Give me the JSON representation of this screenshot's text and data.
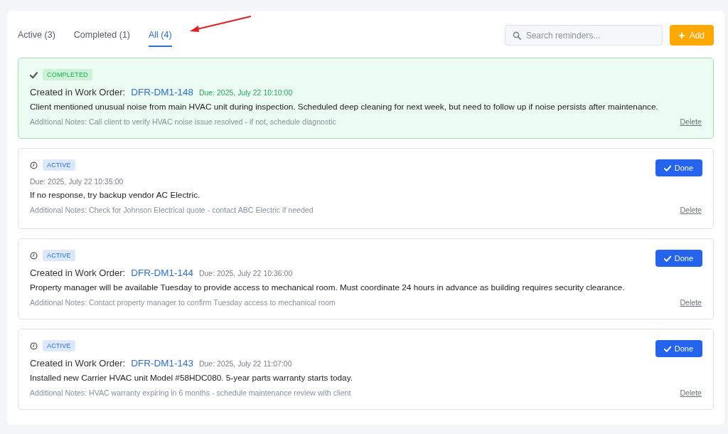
{
  "tabs": [
    {
      "label": "Active (3)",
      "selected": false
    },
    {
      "label": "Completed (1)",
      "selected": false
    },
    {
      "label": "All (4)",
      "selected": true
    }
  ],
  "search": {
    "placeholder": "Search reminders..."
  },
  "add_button": "Add",
  "reminders": [
    {
      "kind": "completed",
      "status": "COMPLETED",
      "created_label": "Created in Work Order:",
      "work_order": "DFR-DM1-148",
      "due": "Due: 2025, July 22 10:10:00",
      "description": "Client mentioned unusual noise from main HVAC unit during inspection. Scheduled deep cleaning for next week, but need to follow up if noise persists after maintenance.",
      "notes": "Additional Notes: Call client to verify HVAC noise issue resolved - if not, schedule diagnostic",
      "delete": "Delete"
    },
    {
      "kind": "active",
      "status": "ACTIVE",
      "due": "Due: 2025, July 22 10:35:00",
      "description": "If no response, try backup vendor AC Electric.",
      "notes": "Additional Notes: Check for Johnson Electrical quote - contact ABC Electric if needed",
      "done_button": "Done",
      "delete": "Delete"
    },
    {
      "kind": "active",
      "status": "ACTIVE",
      "created_label": "Created in Work Order:",
      "work_order": "DFR-DM1-144",
      "due": "Due: 2025, July 22 10:36:00",
      "description": "Property manager will be available Tuesday to provide access to mechanical room. Must coordinate 24 hours in advance as building requires security clearance.",
      "notes": "Additional Notes: Contact property manager to confirm Tuesday access to mechanical room",
      "done_button": "Done",
      "delete": "Delete"
    },
    {
      "kind": "active",
      "status": "ACTIVE",
      "created_label": "Created in Work Order:",
      "work_order": "DFR-DM1-143",
      "due": "Due: 2025, July 22 11:07:00",
      "description": "Installed new Carrier HVAC unit Model #58HDC080. 5-year parts warranty starts today.",
      "notes": "Additional Notes: HVAC warranty expiring in 6 months - schedule maintenance review with client",
      "done_button": "Done",
      "delete": "Delete"
    }
  ]
}
